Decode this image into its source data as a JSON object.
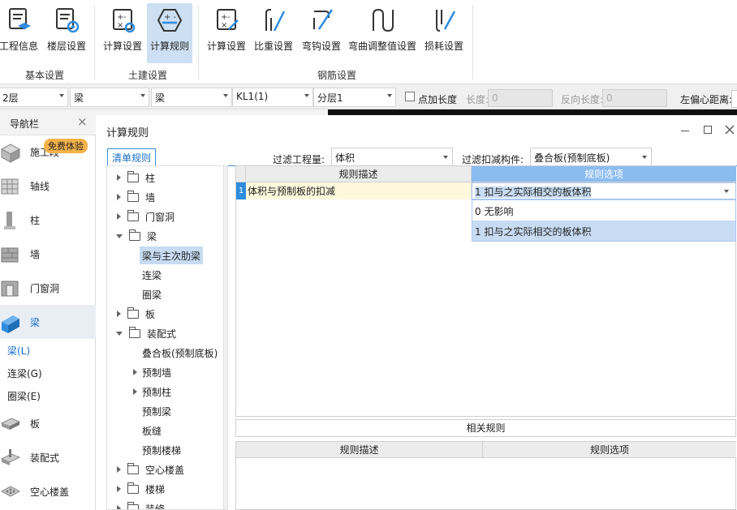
{
  "ribbon": {
    "buttons": [
      {
        "label": "工程信息"
      },
      {
        "label": "楼层设置"
      },
      {
        "label": "计算设置"
      },
      {
        "label": "计算规则"
      },
      {
        "label": "计算设置"
      },
      {
        "label": "比重设置"
      },
      {
        "label": "弯钩设置"
      },
      {
        "label": "弯曲调整值设置"
      },
      {
        "label": "损耗设置"
      }
    ],
    "groups": [
      "基本设置",
      "土建设置",
      "钢筋设置"
    ]
  },
  "toolbar": {
    "floor": "2层",
    "category1": "梁",
    "category2": "梁",
    "element": "KL1(1)",
    "layer": "分层1",
    "point_length_label": "点加长度",
    "length_label": "长度:",
    "length_value": "0",
    "reverse_length_label": "反向长度:",
    "reverse_length_value": "0",
    "left_offset_label": "左偏心距离:"
  },
  "nav": {
    "title": "导航栏",
    "close": "×",
    "badge": "免费体验",
    "items": [
      {
        "label": "施工段"
      },
      {
        "label": "轴线"
      },
      {
        "label": "柱"
      },
      {
        "label": "墙"
      },
      {
        "label": "门窗洞"
      },
      {
        "label": "梁"
      },
      {
        "label": "板"
      },
      {
        "label": "装配式"
      },
      {
        "label": "空心楼盖"
      }
    ],
    "sub_items": [
      "梁(L)",
      "连梁(G)",
      "圈梁(E)"
    ]
  },
  "dialog": {
    "title": "计算规则",
    "tab": "清单规则",
    "filter_quantity_label": "过滤工程量:",
    "filter_quantity_value": "体积",
    "filter_component_label": "过滤扣减构件:",
    "filter_component_value": "叠合板(预制底板)",
    "tree": {
      "柱": "柱",
      "墙": "墙",
      "门窗洞": "门窗洞",
      "梁": "梁",
      "梁与主次肋梁": "梁与主次肋梁",
      "连梁": "连梁",
      "圈梁": "圈梁",
      "板": "板",
      "装配式": "装配式",
      "叠合板": "叠合板(预制底板)",
      "预制墙": "预制墙",
      "预制柱": "预制柱",
      "预制梁": "预制梁",
      "板缝": "板缝",
      "预制楼梯": "预制楼梯",
      "空心楼盖": "空心楼盖",
      "楼梯": "楼梯",
      "装修": "装修"
    },
    "grid": {
      "col_desc": "规则描述",
      "col_option": "规则选项",
      "row_num": "1",
      "row_desc": "体积与预制板的扣减",
      "row_option": "1 扣与之实际相交的板体积",
      "dropdown_options": [
        "0  无影响",
        "1 扣与之实际相交的板体积"
      ]
    },
    "related_label": "相关规则",
    "grid2": {
      "col_desc": "规则描述",
      "col_option": "规则选项"
    }
  },
  "colors": {
    "accent": "#3b8fdc",
    "selected_row": "#c7dcf2",
    "row_highlight": "#fff8dc"
  }
}
